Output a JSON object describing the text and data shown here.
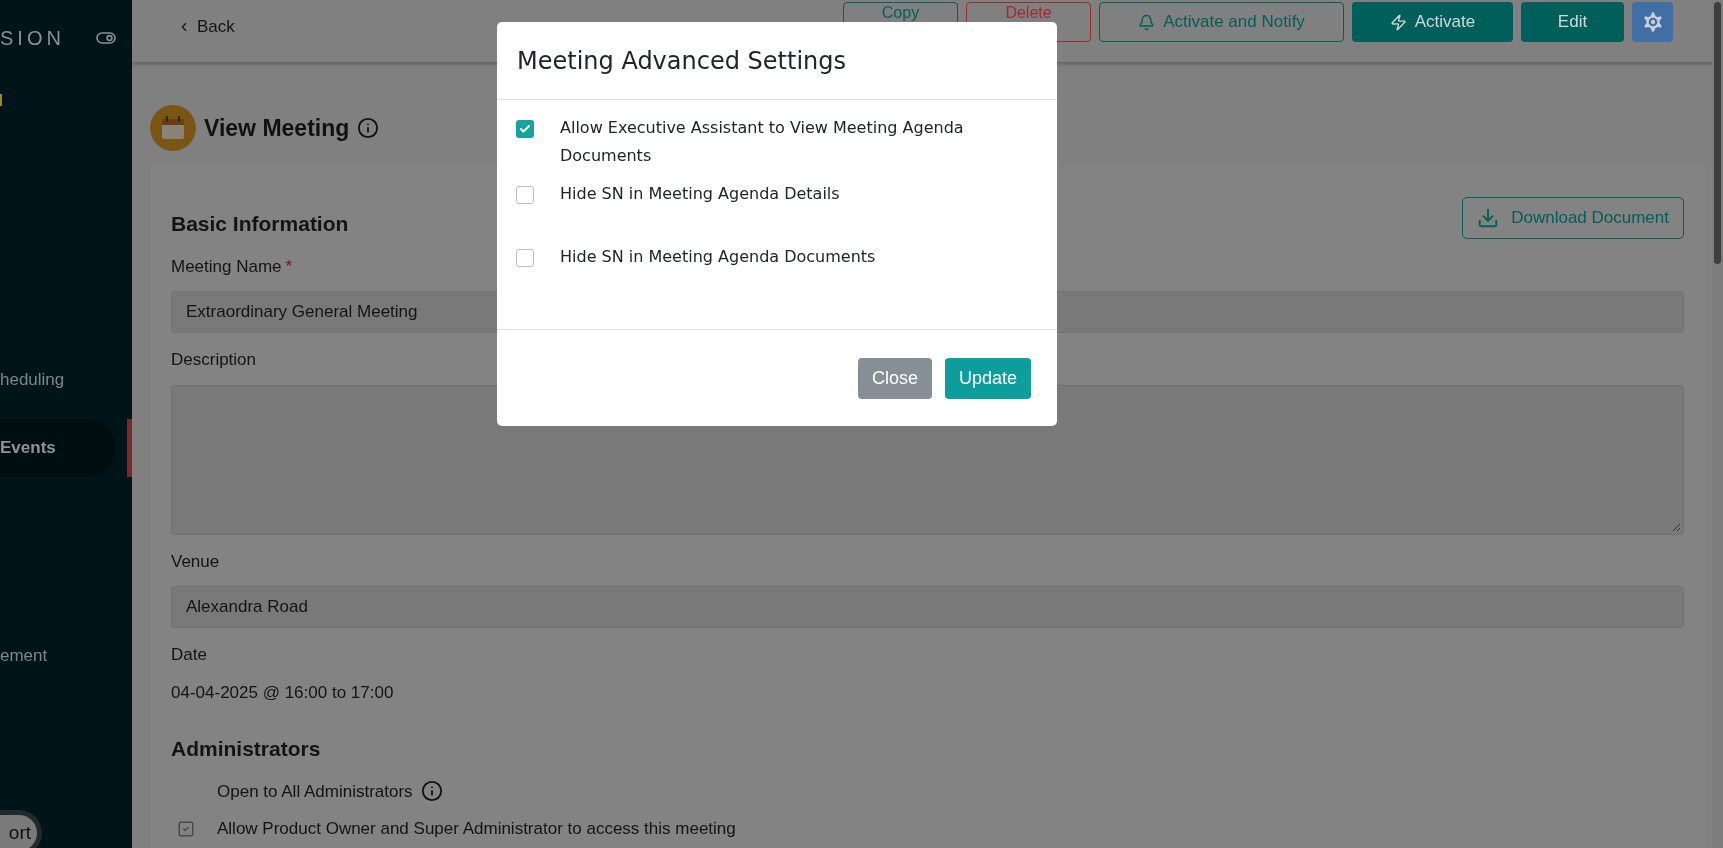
{
  "sidebar": {
    "brand": "SION",
    "items": [
      {
        "label": "heduling",
        "selected": false
      },
      {
        "label": "Events",
        "selected": true
      },
      {
        "label": "ement",
        "selected": false
      }
    ],
    "bottom_button": "ort"
  },
  "top_bar": {
    "back": "Back",
    "buttons": [
      {
        "label": "Copy",
        "kind": "outline"
      },
      {
        "label": "Delete",
        "kind": "danger"
      },
      {
        "label": "Activate and Notify",
        "kind": "notify"
      },
      {
        "label": "Activate",
        "kind": "activate"
      },
      {
        "label": "Edit",
        "kind": "solid"
      },
      {
        "kind": "settings"
      }
    ]
  },
  "page": {
    "title": "View Meeting",
    "download": "Download Document",
    "section": "Basic Information",
    "fields": [
      {
        "label": "Meeting Name",
        "required_mark": "*",
        "kind": "input",
        "value": "Extraordinary General Meeting"
      },
      {
        "label": "Description",
        "kind": "textarea"
      },
      {
        "label": "Venue",
        "kind": "input",
        "value": "Alexandra Road"
      },
      {
        "label": "Date",
        "kind": "text",
        "value": "04-04-2025 @ 16:00 to 17:00"
      }
    ],
    "admins_title": "Administrators",
    "open_all": "Open to All Administrators",
    "allow_owner": {
      "label": "Allow Product Owner and Super Administrator to access this meeting",
      "checked": true
    }
  },
  "modal": {
    "title": "Meeting Advanced Settings",
    "options": [
      {
        "label": "Allow Executive Assistant to View Meeting Agenda Documents",
        "checked": true
      },
      {
        "label": "Hide SN in Meeting Agenda Details",
        "checked": false
      },
      {
        "label": "Hide SN in Meeting Agenda Documents",
        "checked": false
      }
    ],
    "buttons": [
      {
        "label": "Close",
        "kind": "secondary"
      },
      {
        "label": "Update",
        "kind": "primary"
      }
    ]
  }
}
